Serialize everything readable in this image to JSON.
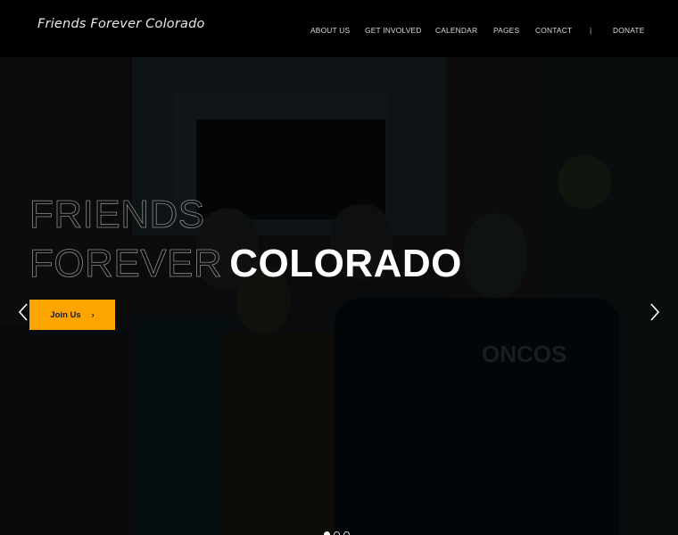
{
  "header": {
    "logo": "Friends Forever Colorado",
    "nav": [
      {
        "label": "ABOUT US"
      },
      {
        "label": "GET INVOLVED"
      },
      {
        "label": "CALENDAR"
      },
      {
        "label": "PAGES"
      },
      {
        "label": "CONTACT"
      },
      {
        "label": "DONATE"
      }
    ],
    "separator": "|"
  },
  "hero": {
    "line1": "FRIENDS",
    "line2_thin": "FOREVER",
    "line2_bold": "COLORADO",
    "cta_label": "Join Us",
    "cta_icon": "chevron-right-icon",
    "cta_color": "#ffa500",
    "prev_icon": "chevron-left-icon",
    "next_icon": "chevron-right-icon",
    "slides_total": 3,
    "active_slide": 1,
    "shirt_text": "ONCOS"
  }
}
